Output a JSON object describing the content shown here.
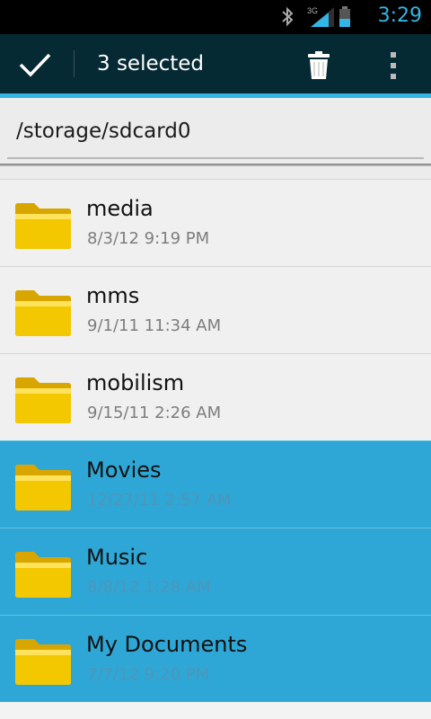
{
  "status_bar": {
    "time": "3:29",
    "network_label": "3G",
    "icons": [
      "bluetooth-icon",
      "signal-icon",
      "battery-icon"
    ],
    "accent": "#33b5e5"
  },
  "action_bar": {
    "selected_label": "3 selected",
    "icons": [
      "checkmark-icon",
      "trash-icon",
      "overflow-menu-icon"
    ],
    "background": "#062a34"
  },
  "path": {
    "current": "/storage/sdcard0"
  },
  "files": [
    {
      "name": "media",
      "date": "8/3/12 9:19 PM",
      "selected": false
    },
    {
      "name": "mms",
      "date": "9/1/11 11:34 AM",
      "selected": false
    },
    {
      "name": "mobilism",
      "date": "9/15/11 2:26 AM",
      "selected": false
    },
    {
      "name": "Movies",
      "date": "12/27/11 2:57 AM",
      "selected": true
    },
    {
      "name": "Music",
      "date": "8/8/12 1:28 AM",
      "selected": true
    },
    {
      "name": "My Documents",
      "date": "7/7/12 9:20 PM",
      "selected": true
    }
  ],
  "colors": {
    "selected_row": "#2fa7d6",
    "folder": "#f1c100"
  }
}
